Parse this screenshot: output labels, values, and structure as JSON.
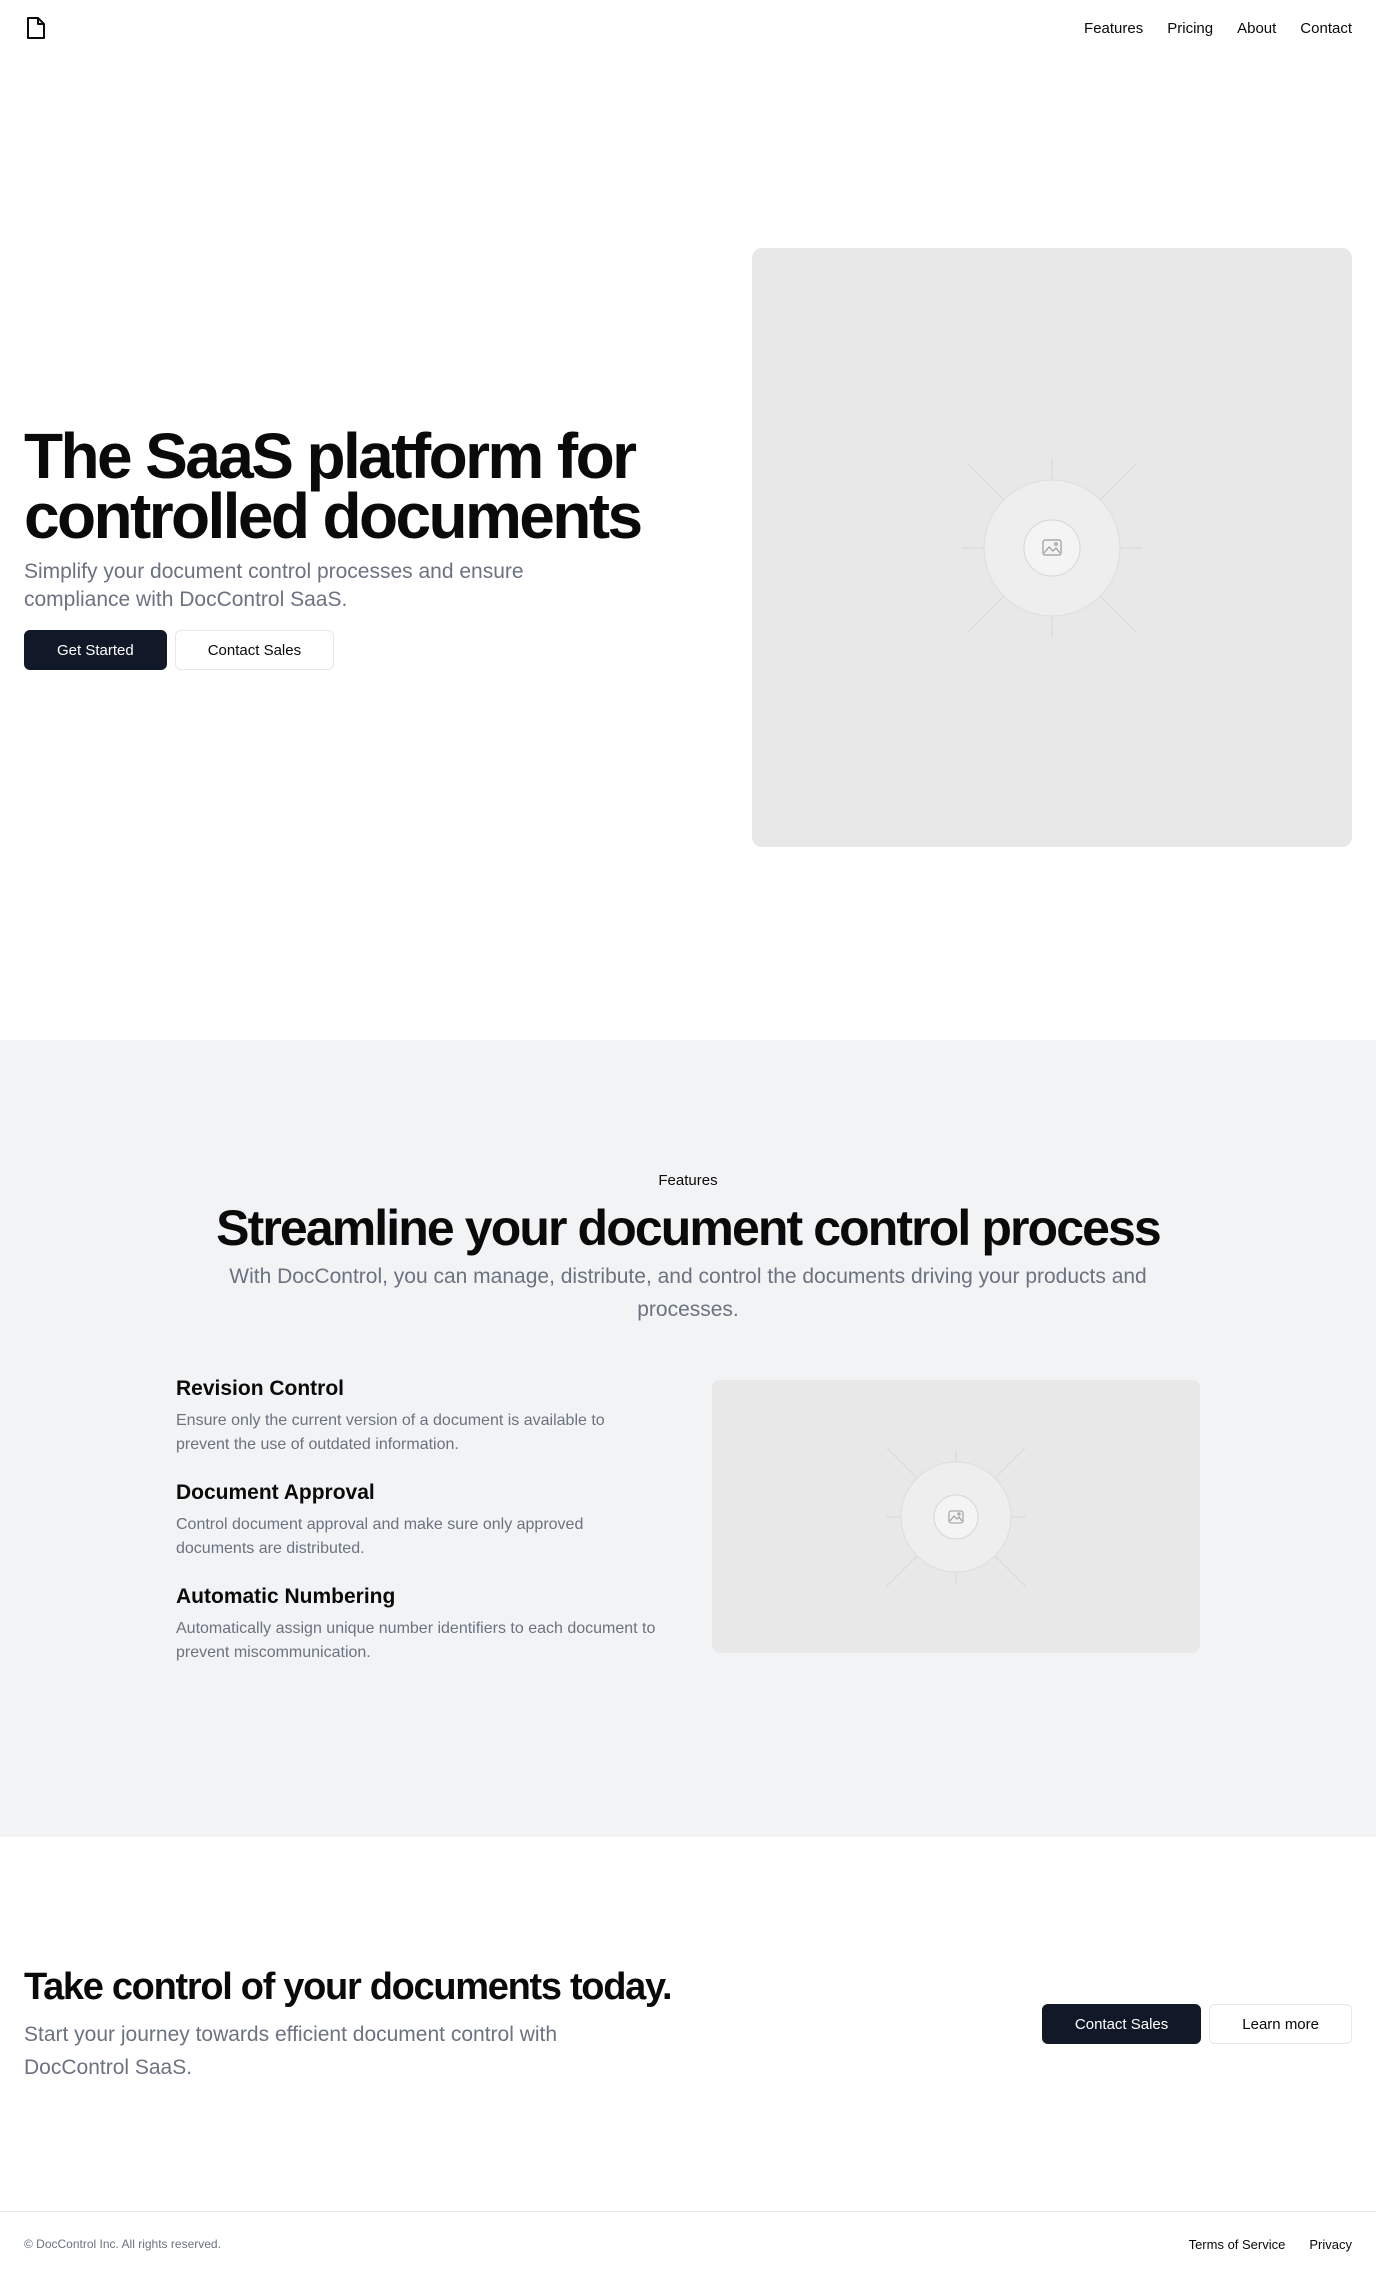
{
  "nav": {
    "logo_icon": "document-icon",
    "links": [
      "Features",
      "Pricing",
      "About",
      "Contact"
    ]
  },
  "hero": {
    "title": "The SaaS platform for controlled documents",
    "subtitle": "Simplify your document control processes and ensure compliance with DocControl SaaS.",
    "primary_button": "Get Started",
    "secondary_button": "Contact Sales",
    "image_icon": "image-placeholder-icon"
  },
  "features": {
    "eyebrow": "Features",
    "title": "Streamline your document control process",
    "subtitle": "With DocControl, you can manage, distribute, and control the documents driving your products and processes.",
    "items": [
      {
        "title": "Revision Control",
        "description": "Ensure only the current version of a document is available to prevent the use of outdated information."
      },
      {
        "title": "Document Approval",
        "description": "Control document approval and make sure only approved documents are distributed."
      },
      {
        "title": "Automatic Numbering",
        "description": "Automatically assign unique number identifiers to each document to prevent miscommunication."
      }
    ]
  },
  "cta": {
    "title": "Take control of your documents today.",
    "subtitle": "Start your journey towards efficient document control with DocControl SaaS.",
    "primary_button": "Contact Sales",
    "secondary_button": "Learn more"
  },
  "footer": {
    "copyright": "© DocControl Inc. All rights reserved.",
    "links": [
      "Terms of Service",
      "Privacy"
    ]
  },
  "colors": {
    "primary": "#111827",
    "muted_text": "#6b7280",
    "section_bg": "#f2f3f5",
    "placeholder_bg": "#e8e8e8"
  }
}
